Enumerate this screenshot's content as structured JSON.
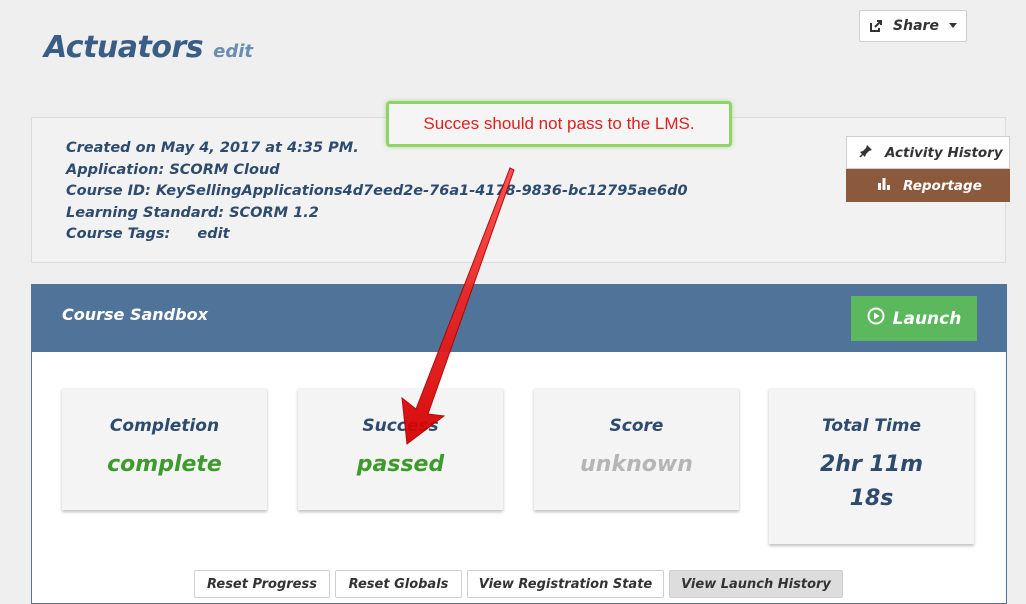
{
  "header": {
    "title": "Actuators",
    "title_edit": "edit",
    "share_label": "Share"
  },
  "info": {
    "created": "Created on May 4, 2017 at 4:35 PM.",
    "application": "Application: SCORM Cloud",
    "course_id": "Course ID: KeySellingApplications4d7eed2e-76a1-4178-9836-bc12795ae6d0",
    "learning_standard": "Learning Standard: SCORM 1.2",
    "course_tags_label": "Course Tags:",
    "course_tags_edit": "edit"
  },
  "side_menu": {
    "activity_history": "Activity History",
    "reportage": "Reportage"
  },
  "annotation": {
    "text": "Succes should not pass to the LMS."
  },
  "sandbox": {
    "title": "Course Sandbox",
    "launch_label": "Launch",
    "stats": [
      {
        "label": "Completion",
        "value": "complete"
      },
      {
        "label": "Success",
        "value": "passed"
      },
      {
        "label": "Score",
        "value": "unknown"
      },
      {
        "label": "Total Time",
        "value_line1": "2hr 11m",
        "value_line2": "18s"
      }
    ],
    "buttons": [
      "Reset Progress",
      "Reset Globals",
      "View Registration State",
      "View Launch History"
    ]
  },
  "colors": {
    "accent": "#4f7399",
    "launch": "#5cb85c",
    "reportage": "#8b5a3c",
    "status_green": "#3d9b2c",
    "annotation_red": "#e02020",
    "annotation_border": "#8fd36a"
  },
  "icons": {
    "share": "share-icon",
    "pin": "pin-icon",
    "bar_chart": "bar-chart-icon",
    "play_circle": "play-circle-icon",
    "caret": "caret-down-icon"
  }
}
